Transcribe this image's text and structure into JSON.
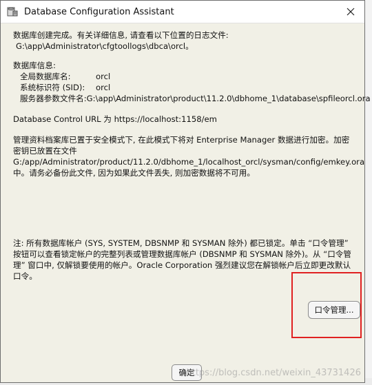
{
  "window": {
    "title": "Database Configuration Assistant"
  },
  "message": {
    "created_line": "数据库创建完成。有关详细信息, 请查看以下位置的日志文件:",
    "log_path": "G:\\app\\Administrator\\cfgtoollogs\\dbca\\orcl。",
    "db_info_heading": "数据库信息:",
    "info_rows": [
      {
        "label": "全局数据库名:",
        "value": "orcl"
      },
      {
        "label": "系统标识符 (SID):",
        "value": "orcl"
      },
      {
        "label": "服务器参数文件名:",
        "value": "G:\\app\\Administrator\\product\\11.2.0\\dbhome_1\\database\\spfileorcl.ora"
      }
    ],
    "control_url": "Database Control URL 为 https://localhost:1158/em",
    "repo_text": "管理资料档案库已置于安全模式下, 在此模式下将对 Enterprise Manager 数据进行加密。加密密钥已放置在文件 G:/app/Administrator/product/11.2.0/dbhome_1/localhost_orcl/sysman/config/emkey.ora 中。请务必备份此文件, 因为如果此文件丢失, 则加密数据将不可用。",
    "note_text": "注: 所有数据库帐户 (SYS, SYSTEM, DBSNMP 和 SYSMAN 除外) 都已锁定。单击 “口令管理” 按钮可以查看锁定帐户的完整列表或管理数据库帐户 (DBSNMP 和 SYSMAN 除外)。从 “口令管理” 窗口中, 仅解锁要使用的帐户。Oracle Corporation 强烈建议您在解锁帐户后立即更改默认口令。"
  },
  "buttons": {
    "password_mgmt": "口令管理...",
    "ok": "确定"
  },
  "watermark": "https://blog.csdn.net/weixin_43731426",
  "colors": {
    "dialog_bg": "#f1f0e6",
    "highlight": "#e02020"
  }
}
